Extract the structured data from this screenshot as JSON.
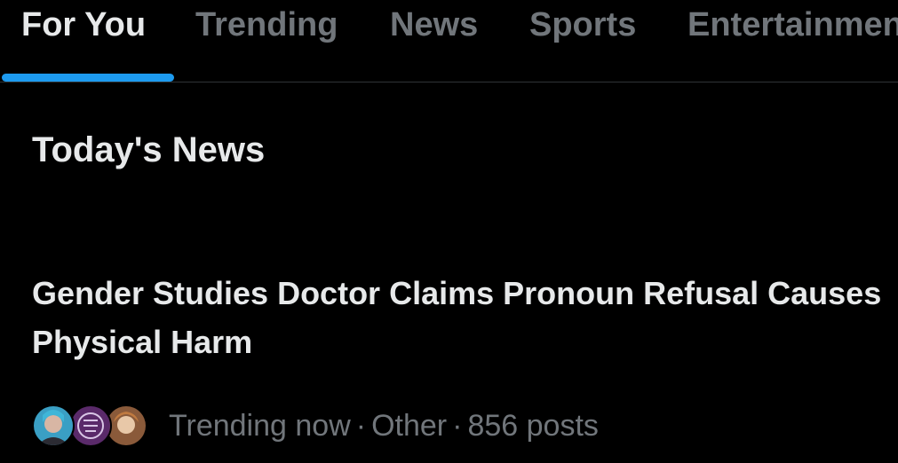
{
  "tabs": [
    {
      "label": "For You",
      "active": true
    },
    {
      "label": "Trending",
      "active": false
    },
    {
      "label": "News",
      "active": false
    },
    {
      "label": "Sports",
      "active": false
    },
    {
      "label": "Entertainment",
      "active": false
    }
  ],
  "section": {
    "title": "Today's News"
  },
  "story": {
    "headline": "Gender Studies Doctor Claims Pronoun Refusal Causes Physical Harm",
    "meta": {
      "status": "Trending now",
      "separator": "·",
      "category": "Other",
      "posts": "856 posts"
    },
    "avatars": [
      "avatar-1",
      "avatar-2",
      "avatar-3"
    ]
  },
  "colors": {
    "background": "#000000",
    "text_primary": "#e7e9ea",
    "text_secondary": "#71767b",
    "accent": "#1d9bf0",
    "divider": "#2f3336"
  }
}
